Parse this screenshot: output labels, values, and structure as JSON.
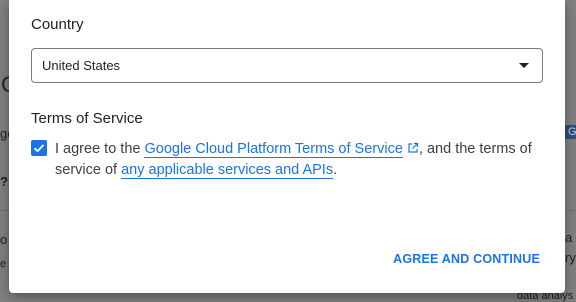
{
  "background": {
    "left_fragments": [
      "ge",
      "C",
      "?",
      "o",
      "e"
    ],
    "right_fragments": [
      "G",
      "a",
      "ry",
      "data analys"
    ]
  },
  "dialog": {
    "country_title": "Country",
    "country_select": {
      "value": "United States"
    },
    "tos_title": "Terms of Service",
    "checkbox_checked": true,
    "tos_text": {
      "prefix": "I agree to the ",
      "link1": "Google Cloud Platform Terms of Service",
      "middle": ", and the terms of service of ",
      "link2": "any applicable services and APIs",
      "suffix": "."
    },
    "agree_button": "AGREE AND CONTINUE"
  },
  "colors": {
    "accent": "#1a73e8",
    "overlay": "#7f7f7f"
  }
}
